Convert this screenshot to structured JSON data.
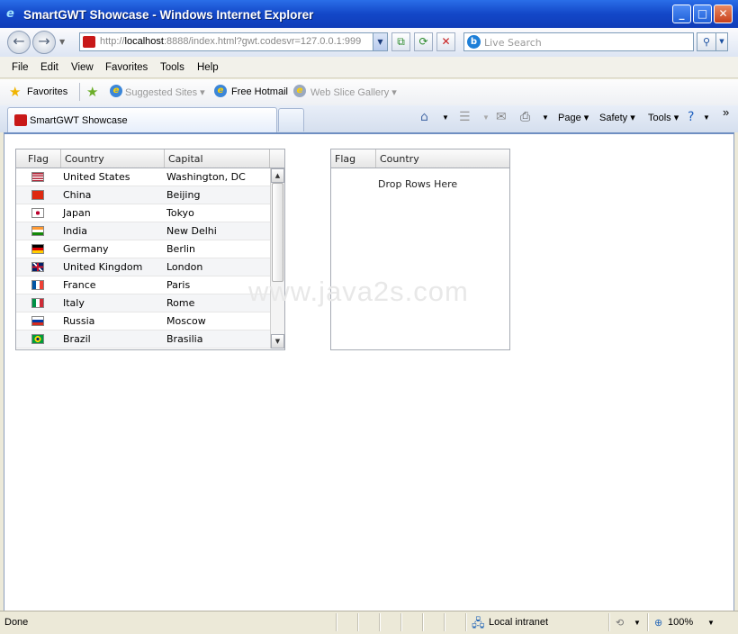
{
  "window": {
    "title": "SmartGWT Showcase - Windows Internet Explorer",
    "minimize": "_",
    "maximize": "□",
    "close": "✕"
  },
  "address": {
    "host": "localhost",
    "prefix": "http://",
    "suffix": ":8888/index.html?gwt.codesvr=127.0.0.1:999"
  },
  "search": {
    "placeholder": "Live Search"
  },
  "menu": [
    "File",
    "Edit",
    "View",
    "Favorites",
    "Tools",
    "Help"
  ],
  "favorites": {
    "label": "Favorites",
    "items": [
      "Suggested Sites ▾",
      "Free Hotmail",
      "Web Slice Gallery ▾"
    ]
  },
  "tab": {
    "label": "SmartGWT Showcase"
  },
  "commands": {
    "page": "Page ▾",
    "safety": "Safety ▾",
    "tools": "Tools ▾",
    "more": "»"
  },
  "source_grid": {
    "headers": [
      "Flag",
      "Country",
      "Capital"
    ],
    "rows": [
      {
        "flag": "us",
        "country": "United States",
        "capital": "Washington, DC"
      },
      {
        "flag": "cn",
        "country": "China",
        "capital": "Beijing"
      },
      {
        "flag": "jp",
        "country": "Japan",
        "capital": "Tokyo"
      },
      {
        "flag": "in",
        "country": "India",
        "capital": "New Delhi"
      },
      {
        "flag": "de",
        "country": "Germany",
        "capital": "Berlin"
      },
      {
        "flag": "gb",
        "country": "United Kingdom",
        "capital": "London"
      },
      {
        "flag": "fr",
        "country": "France",
        "capital": "Paris"
      },
      {
        "flag": "it",
        "country": "Italy",
        "capital": "Rome"
      },
      {
        "flag": "ru",
        "country": "Russia",
        "capital": "Moscow"
      },
      {
        "flag": "br",
        "country": "Brazil",
        "capital": "Brasilia"
      }
    ]
  },
  "target_grid": {
    "headers": [
      "Flag",
      "Country"
    ],
    "empty_message": "Drop Rows Here"
  },
  "watermark": "www.java2s.com",
  "status": {
    "text": "Done",
    "zone": "Local intranet",
    "zoom": "100%"
  }
}
